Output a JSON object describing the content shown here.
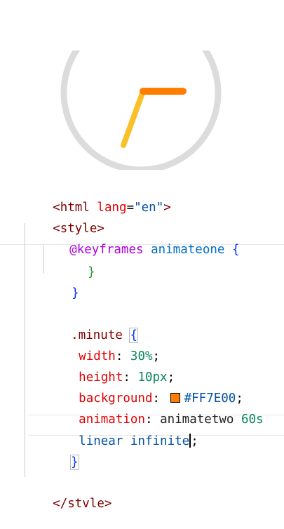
{
  "clock": {
    "face_color": "#dcdcdc",
    "minute_hand_color": "#FF7E00",
    "hour_hand_color": "#F9C02A"
  },
  "code": {
    "html_open": {
      "lt": "<",
      "tag": "html",
      "attr": "lang",
      "eq": "=",
      "value": "\"en\"",
      "gt": ">"
    },
    "style_open": {
      "lt": "<",
      "tag": "style",
      "gt": ">"
    },
    "keyframes": {
      "at": "@keyframes",
      "name": "animateone",
      "brace": "{"
    },
    "inner_close": "}",
    "outer_close": "}",
    "minute": {
      "selector": ".minute",
      "brace_open": "{",
      "width_prop": "width",
      "width_val": "30%",
      "height_prop": "height",
      "height_val": "10px",
      "bg_prop": "background",
      "bg_val": "#FF7E00",
      "bg_color": "#FF7E00",
      "anim_prop": "animation",
      "anim_name": "animatetwo",
      "anim_dur": "60s",
      "anim_rest": "linear infinite",
      "semicolon": ";",
      "brace_close": "}"
    },
    "style_close": {
      "lt": "</",
      "tag": "stvle",
      "gt": ">"
    }
  }
}
